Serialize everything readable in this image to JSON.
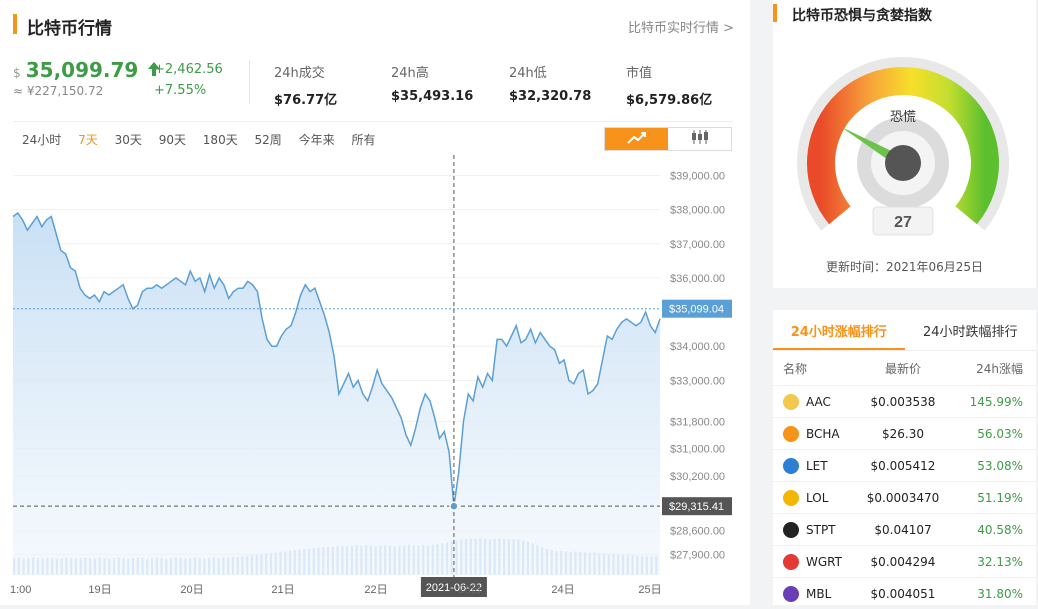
{
  "header": {
    "title": "比特币行情",
    "more_link": "比特币实时行情 >"
  },
  "price": {
    "currency_symbol": "$",
    "value": "35,099.79",
    "cny": "≈ ¥227,150.72",
    "change_abs": "+2,462.56",
    "change_pct": "+7.55%"
  },
  "stats": [
    {
      "label": "24h成交",
      "value": "$76.77亿"
    },
    {
      "label": "24h高",
      "value": "$35,493.16"
    },
    {
      "label": "24h低",
      "value": "$32,320.78"
    },
    {
      "label": "市值",
      "value": "$6,579.86亿"
    }
  ],
  "range_tabs": [
    {
      "label": "24小时",
      "active": false
    },
    {
      "label": "7天",
      "active": true
    },
    {
      "label": "30天",
      "active": false
    },
    {
      "label": "90天",
      "active": false
    },
    {
      "label": "180天",
      "active": false
    },
    {
      "label": "52周",
      "active": false
    },
    {
      "label": "今年来",
      "active": false
    },
    {
      "label": "所有",
      "active": false
    }
  ],
  "chart_icons": {
    "line": "line-chart-icon",
    "candle": "candlestick-icon"
  },
  "chart_data": {
    "type": "area",
    "y_ticks": [
      "$39,000.00",
      "$38,000.00",
      "$37,000.00",
      "$36,000.00",
      "$35,099.04",
      "$34,000.00",
      "$33,000.00",
      "$31,800.00",
      "$31,000.00",
      "$30,200.00",
      "$29,315.41",
      "$28,600.00",
      "$27,900.00"
    ],
    "x_ticks": [
      "1:00",
      "19日",
      "20日",
      "21日",
      "22日",
      "2021-06-22",
      "23日",
      "24日",
      "25日"
    ],
    "current_price_label": "$35,099.04",
    "crosshair_price_label": "$29,315.41",
    "crosshair_date_label": "2021-06-22",
    "current_price": 35099.04,
    "crosshair_price": 29315.41,
    "ylim": [
      27300,
      39600
    ],
    "series": [
      {
        "values": [
          37800,
          37900,
          37700,
          37400,
          37600,
          37800,
          37500,
          37700,
          37800,
          37300,
          36800,
          36700,
          36300,
          36200,
          35700,
          35500,
          35400,
          35500,
          35300,
          35600,
          35500,
          35600,
          35700,
          35800,
          35400,
          35100,
          35200,
          35600,
          35700,
          35700,
          35800,
          35700,
          35800,
          35900,
          36000,
          35900,
          35800,
          36200,
          35900,
          36000,
          35600,
          36100,
          35700,
          36000,
          35800,
          35400,
          35600,
          35700,
          35700,
          35900,
          35800,
          35600,
          34800,
          34200,
          34000,
          34000,
          34300,
          34500,
          34600,
          35000,
          35500,
          35800,
          35600,
          35700,
          35300,
          34900,
          34400,
          33700,
          32600,
          32900,
          33200,
          32800,
          33000,
          32600,
          32400,
          32800,
          33300,
          32900,
          32700,
          32500,
          32200,
          31900,
          31400,
          31100,
          31600,
          32200,
          32600,
          32400,
          31900,
          31300,
          31500,
          30900,
          29315,
          30300,
          31800,
          32600,
          32400,
          33100,
          32800,
          33200,
          33000,
          34200,
          34200,
          34000,
          34300,
          34600,
          34100,
          34200,
          34500,
          34100,
          34400,
          34200,
          34000,
          33900,
          33500,
          33600,
          33000,
          32900,
          33200,
          33300,
          32600,
          32700,
          32900,
          33600,
          34300,
          34200,
          34500,
          34700,
          34800,
          34700,
          34600,
          34700,
          35000,
          34600,
          34400,
          34800
        ]
      }
    ],
    "volume": [
      0.35,
      0.36,
      0.34,
      0.35,
      0.36,
      0.35,
      0.34,
      0.36,
      0.35,
      0.34,
      0.35,
      0.36,
      0.35,
      0.34,
      0.35,
      0.36,
      0.35,
      0.34,
      0.36,
      0.35,
      0.34,
      0.35,
      0.36,
      0.35,
      0.34,
      0.35,
      0.36,
      0.35,
      0.34,
      0.35,
      0.36,
      0.35,
      0.34,
      0.35,
      0.36,
      0.35,
      0.34,
      0.35,
      0.36,
      0.35,
      0.34,
      0.35,
      0.36,
      0.35,
      0.36,
      0.37,
      0.38,
      0.38,
      0.39,
      0.4,
      0.41,
      0.42,
      0.44,
      0.45,
      0.46,
      0.47,
      0.48,
      0.49,
      0.5,
      0.52,
      0.53,
      0.54,
      0.55,
      0.56,
      0.57,
      0.58,
      0.58,
      0.59,
      0.6,
      0.61,
      0.6,
      0.61,
      0.62,
      0.61,
      0.62,
      0.61,
      0.6,
      0.61,
      0.62,
      0.61,
      0.6,
      0.61,
      0.62,
      0.63,
      0.62,
      0.61,
      0.62,
      0.61,
      0.63,
      0.64,
      0.66,
      0.68,
      0.7,
      0.72,
      0.74,
      0.75,
      0.76,
      0.75,
      0.76,
      0.75,
      0.74,
      0.75,
      0.76,
      0.75,
      0.74,
      0.75,
      0.74,
      0.72,
      0.7,
      0.66,
      0.62,
      0.58,
      0.54,
      0.52,
      0.5,
      0.5,
      0.49,
      0.48,
      0.49,
      0.48,
      0.47,
      0.46,
      0.47,
      0.46,
      0.45,
      0.44,
      0.44,
      0.43,
      0.42,
      0.41,
      0.41,
      0.4,
      0.4,
      0.39,
      0.39,
      0.4
    ]
  },
  "fear_greed": {
    "title": "比特币恐惧与贪婪指数",
    "label": "恐慌",
    "value": "27",
    "score": 27,
    "updated": "更新时间：2021年06月25日"
  },
  "ranking": {
    "tabs": [
      {
        "label": "24小时涨幅排行",
        "active": true
      },
      {
        "label": "24小时跌幅排行",
        "active": false
      }
    ],
    "headers": [
      "名称",
      "最新价",
      "24h涨幅"
    ],
    "rows": [
      {
        "name": "AAC",
        "price": "$0.003538",
        "change": "145.99%",
        "icon": "aac-icon",
        "color": "#f2c94c"
      },
      {
        "name": "BCHA",
        "price": "$26.30",
        "change": "56.03%",
        "icon": "bcha-icon",
        "color": "#f7931a"
      },
      {
        "name": "LET",
        "price": "$0.005412",
        "change": "53.08%",
        "icon": "let-icon",
        "color": "#2d7fd3"
      },
      {
        "name": "LOL",
        "price": "$0.0003470",
        "change": "51.19%",
        "icon": "lol-icon",
        "color": "#f2b705"
      },
      {
        "name": "STPT",
        "price": "$0.04107",
        "change": "40.58%",
        "icon": "stpt-icon",
        "color": "#222222"
      },
      {
        "name": "WGRT",
        "price": "$0.004294",
        "change": "32.13%",
        "icon": "wgrt-icon",
        "color": "#e53935"
      },
      {
        "name": "MBL",
        "price": "$0.004051",
        "change": "31.80%",
        "icon": "mbl-icon",
        "color": "#6a3fb5"
      }
    ]
  },
  "colors": {
    "accent": "#f7931a",
    "up": "#3d9c45",
    "line": "#5a9fd6",
    "fill": "#dbeaf8"
  }
}
